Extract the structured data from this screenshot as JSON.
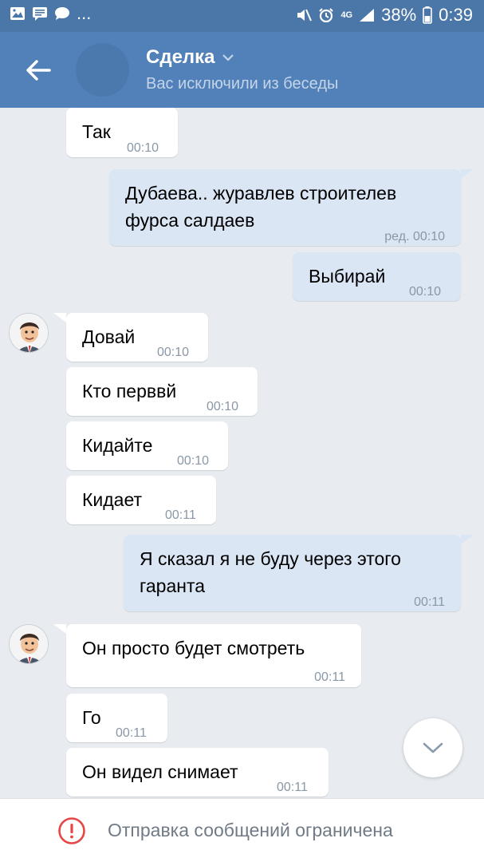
{
  "status_bar": {
    "notif_dots": "...",
    "network": "4G",
    "battery": "38%",
    "time": "0:39"
  },
  "header": {
    "title": "Сделка",
    "subtitle": "Вас исключили из беседы"
  },
  "messages": [
    {
      "text": "Так",
      "time": "00:10"
    },
    {
      "text_line1": "Дубаева.. журавлев строителев",
      "text_line2": "фурса салдаев",
      "time": "ред. 00:10"
    },
    {
      "text": "Выбирай",
      "time": "00:10"
    },
    {
      "text": "Довай",
      "time": "00:10"
    },
    {
      "text": "Кто перввй",
      "time": "00:10"
    },
    {
      "text": "Кидайте",
      "time": "00:10"
    },
    {
      "text": "Кидает",
      "time": "00:11"
    },
    {
      "text_line1": "Я сказал я не буду через этого",
      "text_line2": "гаранта",
      "time": "00:11"
    },
    {
      "text": "Он просто будет смотреть",
      "time": "00:11"
    },
    {
      "text": "Го",
      "time": "00:11"
    },
    {
      "text": "Он видел снимает",
      "time": "00:11"
    }
  ],
  "footer": {
    "restricted_text": "Отправка сообщений ограничена"
  },
  "colors": {
    "header": "#5181b8",
    "status_bar": "#4a77a8",
    "incoming": "#ffffff",
    "outgoing": "#dae6f4",
    "background": "#e8ecf0",
    "warning": "#e64646"
  },
  "icons": [
    "image-icon",
    "message-icon",
    "chat-icon",
    "mute-icon",
    "alarm-icon",
    "signal-icon",
    "battery-icon",
    "back-arrow-icon",
    "chevron-down-icon",
    "warning-icon"
  ]
}
